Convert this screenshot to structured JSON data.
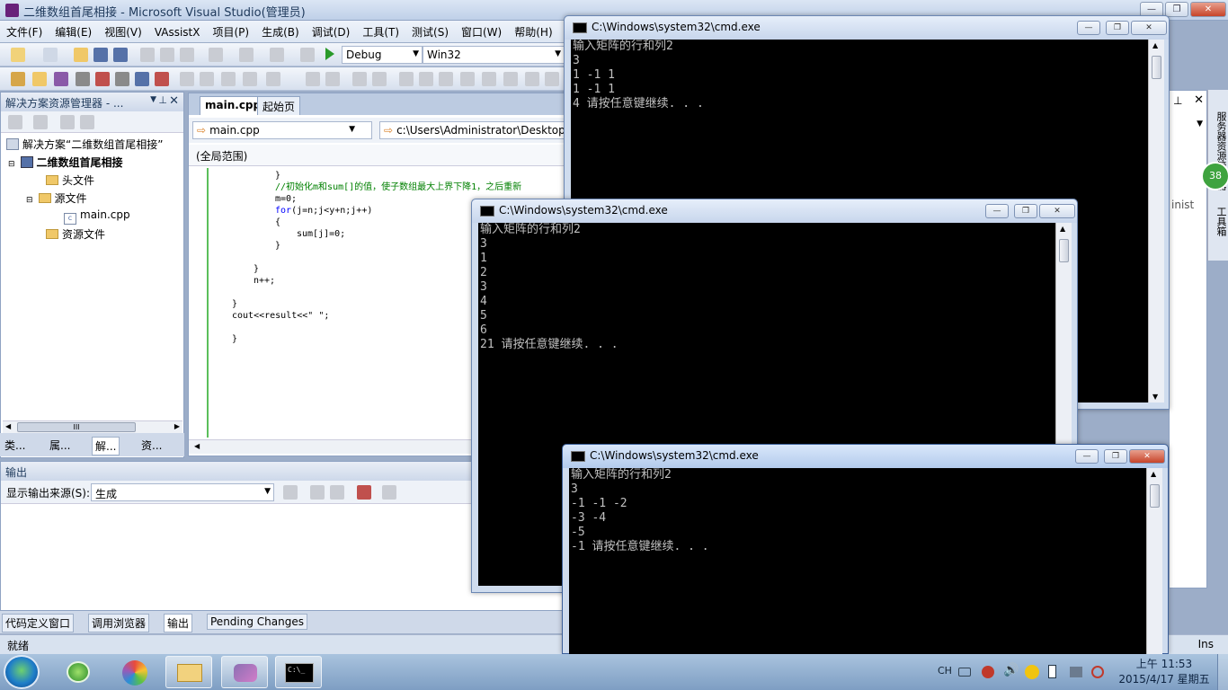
{
  "vs": {
    "title": "二维数组首尾相接 - Microsoft Visual Studio(管理员)",
    "menu": [
      "文件(F)",
      "编辑(E)",
      "视图(V)",
      "VAssistX",
      "项目(P)",
      "生成(B)",
      "调试(D)",
      "工具(T)",
      "测试(S)",
      "窗口(W)",
      "帮助(H)"
    ],
    "config": "Debug",
    "platform": "Win32"
  },
  "solution_explorer": {
    "title": "解决方案资源管理器 - ...",
    "solution": "解决方案“二维数组首尾相接”",
    "project": "二维数组首尾相接",
    "items": [
      "头文件",
      "源文件",
      "main.cpp",
      "资源文件"
    ],
    "scroll_glyph": "III",
    "tabs": [
      "类...",
      "属...",
      "解...",
      "资..."
    ]
  },
  "editor": {
    "tabs": [
      "main.cpp",
      "起始页"
    ],
    "file_dropdown": "main.cpp",
    "path": "c:\\Users\\Administrator\\Desktop",
    "scope": "(全局范围)",
    "code": [
      {
        "indent": 11,
        "text": "}",
        "cls": ""
      },
      {
        "indent": 11,
        "text": "//初始化m和sum[]的值，使子数组最大上界下降1，之后重新",
        "cls": "cm"
      },
      {
        "indent": 11,
        "text": "m=0;",
        "cls": ""
      },
      {
        "indent": 11,
        "text": "for(j=n;j<y+n;j++)",
        "cls": "kwline"
      },
      {
        "indent": 11,
        "text": "{",
        "cls": ""
      },
      {
        "indent": 15,
        "text": "sum[j]=0;",
        "cls": ""
      },
      {
        "indent": 11,
        "text": "}",
        "cls": ""
      },
      {
        "indent": 0,
        "text": "",
        "cls": ""
      },
      {
        "indent": 7,
        "text": "}",
        "cls": ""
      },
      {
        "indent": 7,
        "text": "n++;",
        "cls": ""
      },
      {
        "indent": 0,
        "text": "",
        "cls": ""
      },
      {
        "indent": 3,
        "text": "}",
        "cls": ""
      },
      {
        "indent": 3,
        "text": "cout<<result<<\" \";",
        "cls": ""
      },
      {
        "indent": 0,
        "text": "",
        "cls": ""
      },
      {
        "indent": 3,
        "text": "}",
        "cls": ""
      }
    ]
  },
  "output": {
    "title": "输出",
    "source_label": "显示输出来源(S):",
    "source_value": "生成"
  },
  "bottom_tabs": [
    "代码定义窗口",
    "调用浏览器",
    "输出",
    "Pending Changes"
  ],
  "status": {
    "left": "就绪",
    "right": "Ins"
  },
  "right_panel": {
    "text": "inist",
    "badge": "38",
    "side_labels": [
      "服务器资源管理器",
      "工具箱"
    ]
  },
  "cmd_windows": [
    {
      "title": "C:\\Windows\\system32\\cmd.exe",
      "lines": [
        "输入矩阵的行和列2",
        "3",
        "1 -1 1",
        "1 -1 1",
        "4 请按任意键继续. . ."
      ]
    },
    {
      "title": "C:\\Windows\\system32\\cmd.exe",
      "lines": [
        "输入矩阵的行和列2",
        "3",
        "1",
        "2",
        "3",
        "4",
        "5",
        "6",
        "21 请按任意键继续. . ."
      ]
    },
    {
      "title": "C:\\Windows\\system32\\cmd.exe",
      "lines": [
        "输入矩阵的行和列2",
        "3",
        "-1 -1 -2",
        "-3 -4",
        "-5",
        "-1 请按任意键继续. . ."
      ]
    }
  ],
  "taskbar": {
    "lang": "CH",
    "time": "上午 11:53",
    "date": "2015/4/17 星期五",
    "cmd_icon_text": "C:\\_"
  }
}
